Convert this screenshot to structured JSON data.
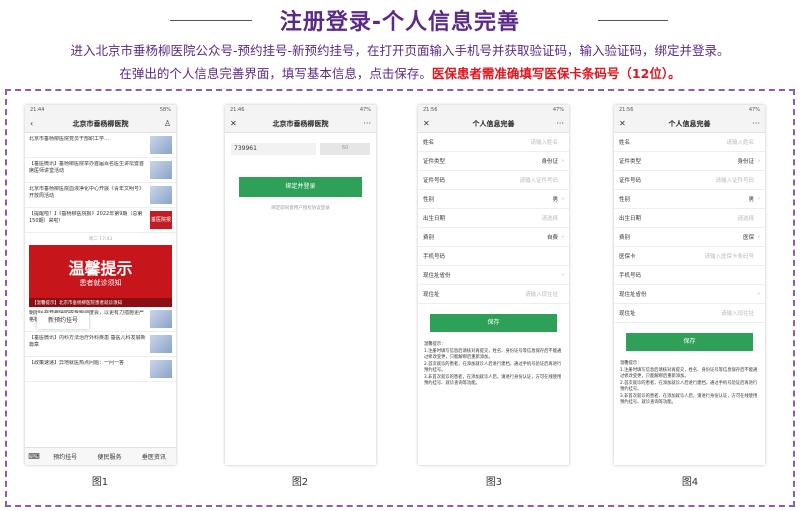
{
  "header": {
    "title": "注册登录-个人信息完善",
    "intro_line1": "进入北京市垂杨柳医院公众号-预约挂号-新预约挂号，在打开页面输入手机号并获取验证码，输入验证码，绑定并登录。",
    "intro_line2_normal": "在弹出的个人信息完善界面，填写基本信息，点击保存。",
    "intro_line2_red": "医保患者需准确填写医保卡条码号（12位）。"
  },
  "captions": [
    "图1",
    "图2",
    "图3",
    "图4"
  ],
  "phone1": {
    "status_time": "21:44",
    "status_right": "58%",
    "title": "北京市垂杨柳医院",
    "news_top": [
      {
        "text": "北京市垂杨柳医院党员干部职工学…",
        "thumb": ""
      },
      {
        "text": "【垂医微讯】垂杨柳医院举办首届百名医生讲坛暨首席医师讲堂活动",
        "thumb": ""
      },
      {
        "text": "北京市垂杨柳医院血液净化中心开展《青年文明号》开放周活动",
        "thumb": ""
      },
      {
        "text": "【提醒啦！】《垂杨柳医院报》2022年第9期（总第150期）来啦！",
        "thumb": "垂医院报"
      }
    ],
    "timestamp": "周二 17:43",
    "banner_title": "温馨提示",
    "banner_sub": "患者就诊须知",
    "banner_caption": "【温馨提示】北京市垂杨柳医院患者就诊须知",
    "news_bottom": [
      {
        "text": "朝阳区召开疫情防控专题调度会，以更有力措施更严格标准，快速阻断疫…"
      },
      {
        "text": "【垂医微讯】内科方法治疗外科疾患 垂医儿科发展新篇章"
      },
      {
        "text": "【政策速递】异地就医热点问题：一问一答"
      }
    ],
    "popup_label": "新预约挂号",
    "tabs": [
      "预约挂号",
      "便民服务",
      "垂医资讯"
    ]
  },
  "phone2": {
    "status_time": "21:46",
    "status_right": "47%",
    "title": "北京市垂杨柳医院",
    "code_value": "739961",
    "code_button": "60",
    "bind_button": "绑定并登录",
    "link": "绑定即同意用户授权协议登录"
  },
  "phone3": {
    "status_time": "21:56",
    "status_right": "47%",
    "title": "个人信息完善",
    "rows": [
      {
        "label": "姓名",
        "value": "请输入姓名",
        "arrow": ""
      },
      {
        "label": "证件类型",
        "value": "身份证",
        "arrow": "›"
      },
      {
        "label": "证件号码",
        "value": "请输入证件号码",
        "arrow": ""
      },
      {
        "label": "性别",
        "value": "男",
        "arrow": "›"
      },
      {
        "label": "出生日期",
        "value": "请选择",
        "arrow": ""
      },
      {
        "label": "费别",
        "value": "自费",
        "arrow": "›"
      },
      {
        "label": "手机号码",
        "value": "",
        "arrow": ""
      },
      {
        "label": "现住址省份",
        "value": "",
        "arrow": "›"
      },
      {
        "label": "现住址",
        "value": "请输入现住址",
        "arrow": ""
      }
    ],
    "save_button": "保存",
    "tips_title": "温馨提示：",
    "tips": [
      "1.注册时填写信息后请核对再提交，姓名、身份证号等信息保存后不能通过修改变更，只能解绑后重新添加。",
      "2.首次就诊的患者，在添加就诊人后进行建档，通过手机号验证后再进行预约挂号。",
      "3.非首次就诊的患者，在添加就诊人后，请进行身份认证，方可在线使用预约挂号、就诊查询等功能。"
    ]
  },
  "phone4": {
    "status_time": "21:56",
    "status_right": "47%",
    "title": "个人信息完善",
    "rows": [
      {
        "label": "姓名",
        "value": "请输入姓名",
        "arrow": ""
      },
      {
        "label": "证件类型",
        "value": "身份证",
        "arrow": "›"
      },
      {
        "label": "证件号码",
        "value": "请输入证件号码",
        "arrow": ""
      },
      {
        "label": "性别",
        "value": "男",
        "arrow": "›"
      },
      {
        "label": "出生日期",
        "value": "请选择",
        "arrow": ""
      },
      {
        "label": "费别",
        "value": "医保",
        "arrow": "›"
      },
      {
        "label": "医保卡",
        "value": "请输入医保卡条码号",
        "arrow": ""
      },
      {
        "label": "手机号码",
        "value": "",
        "arrow": ""
      },
      {
        "label": "现住址省份",
        "value": "",
        "arrow": "›"
      },
      {
        "label": "现住址",
        "value": "请输入现住址",
        "arrow": ""
      }
    ],
    "save_button": "保存",
    "tips_title": "温馨提示：",
    "tips": [
      "1.注册时填写信息后请核对再提交，姓名、身份证号等信息保存后不能通过修改变更，只能解绑后重新添加。",
      "2.首次就诊的患者，在添加就诊人后进行建档，通过手机号验证后再进行预约挂号。",
      "3.非首次就诊的患者，在添加就诊人后，请进行身份认证，方可在线使用预约挂号、就诊查询等功能。"
    ]
  },
  "icons": {
    "back": "‹",
    "close": "✕",
    "more": "···",
    "user": "♙",
    "keyboard": "⌨"
  },
  "colors": {
    "title": "#5b2a86",
    "red": "#e0161e",
    "green": "#2ea058",
    "banner": "#c7151c"
  }
}
